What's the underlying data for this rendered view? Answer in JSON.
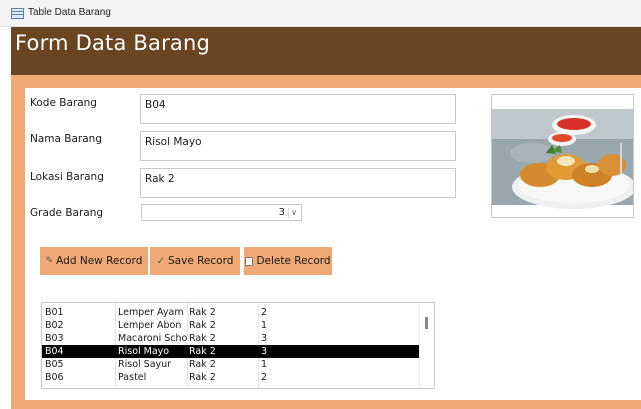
{
  "window": {
    "title": "Table Data Barang"
  },
  "header": {
    "title": "Form Data Barang"
  },
  "form": {
    "kode_label": "Kode Barang",
    "kode_value": "B04",
    "nama_label": "Nama Barang",
    "nama_value": "Risol Mayo",
    "lokasi_label": "Lokasi Barang",
    "lokasi_value": "Rak 2",
    "grade_label": "Grade Barang",
    "grade_value": "3"
  },
  "buttons": {
    "add": "Add New Record",
    "save": "Save Record",
    "delete": "Delete Record"
  },
  "list": {
    "rows": [
      [
        "B01",
        "Lemper Ayam",
        "Rak 2",
        "2"
      ],
      [
        "B02",
        "Lemper Abon",
        "Rak 2",
        "1"
      ],
      [
        "B03",
        "Macaroni Schotel",
        "Rak 2",
        "3"
      ],
      [
        "B04",
        "Risol Mayo",
        "Rak 2",
        "3"
      ],
      [
        "B05",
        "Risol Sayur",
        "Rak 2",
        "1"
      ],
      [
        "B06",
        "Pastel",
        "Rak 2",
        "2"
      ]
    ],
    "selected_index": 3
  },
  "colors": {
    "header_bg": "#6a4521",
    "accent": "#f0a874",
    "selection": "#000000"
  },
  "icons": {
    "window": "table-icon",
    "add": "pencil-icon",
    "save": "check-icon",
    "delete": "trash-icon",
    "combo": "chevron-down-icon"
  }
}
